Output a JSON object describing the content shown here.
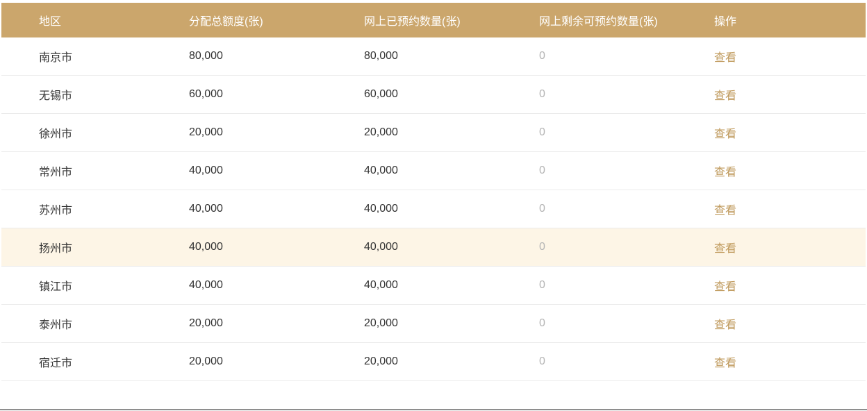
{
  "colors": {
    "header_bg": "#CBA66C",
    "header_text": "#FFFFFF",
    "body_text": "#333333",
    "muted_text": "#B4B4B4",
    "action_text": "#BF995B",
    "highlight_bg": "#FDF5E6",
    "row_divider": "#EBEBEB"
  },
  "table": {
    "columns": [
      "地区",
      "分配总额度(张)",
      "网上已预约数量(张)",
      "网上剩余可预约数量(张)",
      "操作"
    ],
    "rows": [
      {
        "region": "南京市",
        "total": "80,000",
        "booked": "80,000",
        "remaining": "0",
        "action": "查看",
        "highlighted": false
      },
      {
        "region": "无锡市",
        "total": "60,000",
        "booked": "60,000",
        "remaining": "0",
        "action": "查看",
        "highlighted": false
      },
      {
        "region": "徐州市",
        "total": "20,000",
        "booked": "20,000",
        "remaining": "0",
        "action": "查看",
        "highlighted": false
      },
      {
        "region": "常州市",
        "total": "40,000",
        "booked": "40,000",
        "remaining": "0",
        "action": "查看",
        "highlighted": false
      },
      {
        "region": "苏州市",
        "total": "40,000",
        "booked": "40,000",
        "remaining": "0",
        "action": "查看",
        "highlighted": false
      },
      {
        "region": "扬州市",
        "total": "40,000",
        "booked": "40,000",
        "remaining": "0",
        "action": "查看",
        "highlighted": true
      },
      {
        "region": "镇江市",
        "total": "40,000",
        "booked": "40,000",
        "remaining": "0",
        "action": "查看",
        "highlighted": false
      },
      {
        "region": "泰州市",
        "total": "20,000",
        "booked": "20,000",
        "remaining": "0",
        "action": "查看",
        "highlighted": false
      },
      {
        "region": "宿迁市",
        "total": "20,000",
        "booked": "20,000",
        "remaining": "0",
        "action": "查看",
        "highlighted": false
      }
    ]
  }
}
